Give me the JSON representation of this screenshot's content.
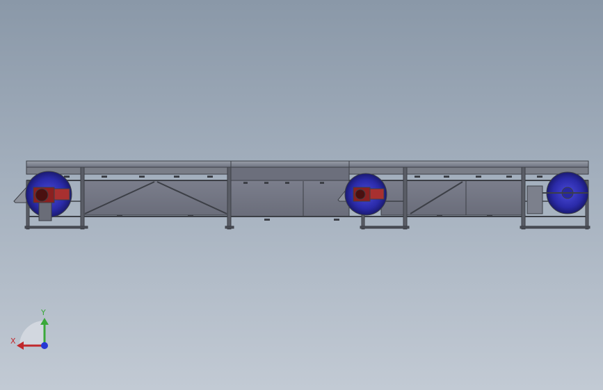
{
  "viewport": {
    "background_top": "#8a98a8",
    "background_bottom": "#c2cad4"
  },
  "model": {
    "frame_color": "#55585e",
    "panel_color": "#6f7280",
    "drum_color": "#2f2fb8",
    "motor_color": "#a02a2a",
    "sections": 3
  },
  "triad": {
    "x_label": "X",
    "y_label": "Y",
    "x_color": "#c0282c",
    "y_color": "#3aa83a",
    "z_color": "#2638d4"
  }
}
